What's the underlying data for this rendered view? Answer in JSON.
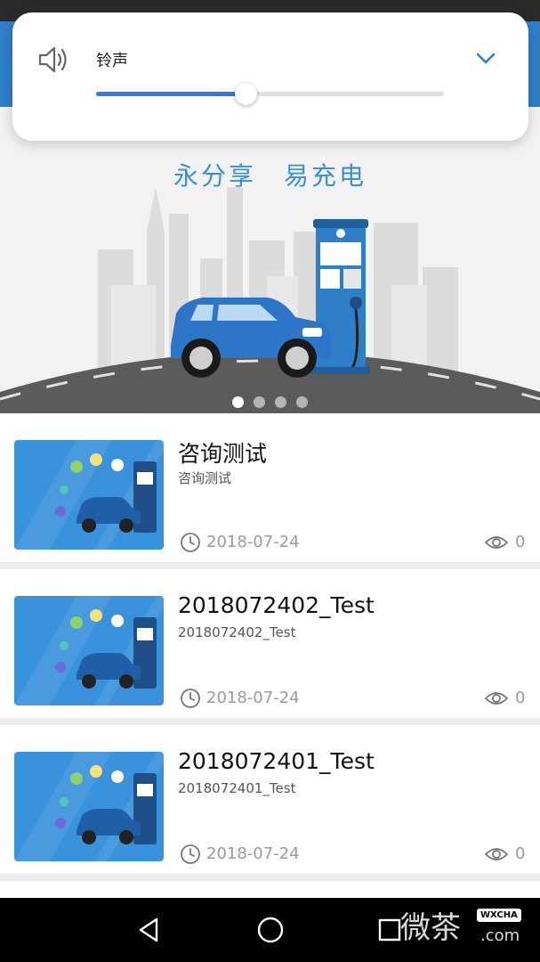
{
  "volume_panel": {
    "icon": "speaker-icon",
    "label": "铃声",
    "expand_icon": "chevron-down-icon",
    "level": 0.43
  },
  "banner": {
    "slogan": "永分享　易充电",
    "page_count": 4,
    "active_page": 1
  },
  "articles": [
    {
      "title": "咨询测试",
      "subtitle": "咨询测试",
      "date": "2018-07-24",
      "views": "0"
    },
    {
      "title": "2018072402_Test",
      "subtitle": "2018072402_Test",
      "date": "2018-07-24",
      "views": "0"
    },
    {
      "title": "2018072401_Test",
      "subtitle": "2018072401_Test",
      "date": "2018-07-24",
      "views": "0"
    }
  ],
  "navbar": {
    "back_icon": "back-triangle-icon",
    "home_icon": "home-circle-icon",
    "recents_icon": "recents-square-icon"
  },
  "watermark": {
    "text": "微茶",
    "badge": "WXCHA",
    "domain": ".com"
  },
  "colors": {
    "accent": "#2c7fd6",
    "appbar": "#2f7fc8",
    "slogan": "#3d8fd0",
    "meta": "#9a9a9a"
  }
}
